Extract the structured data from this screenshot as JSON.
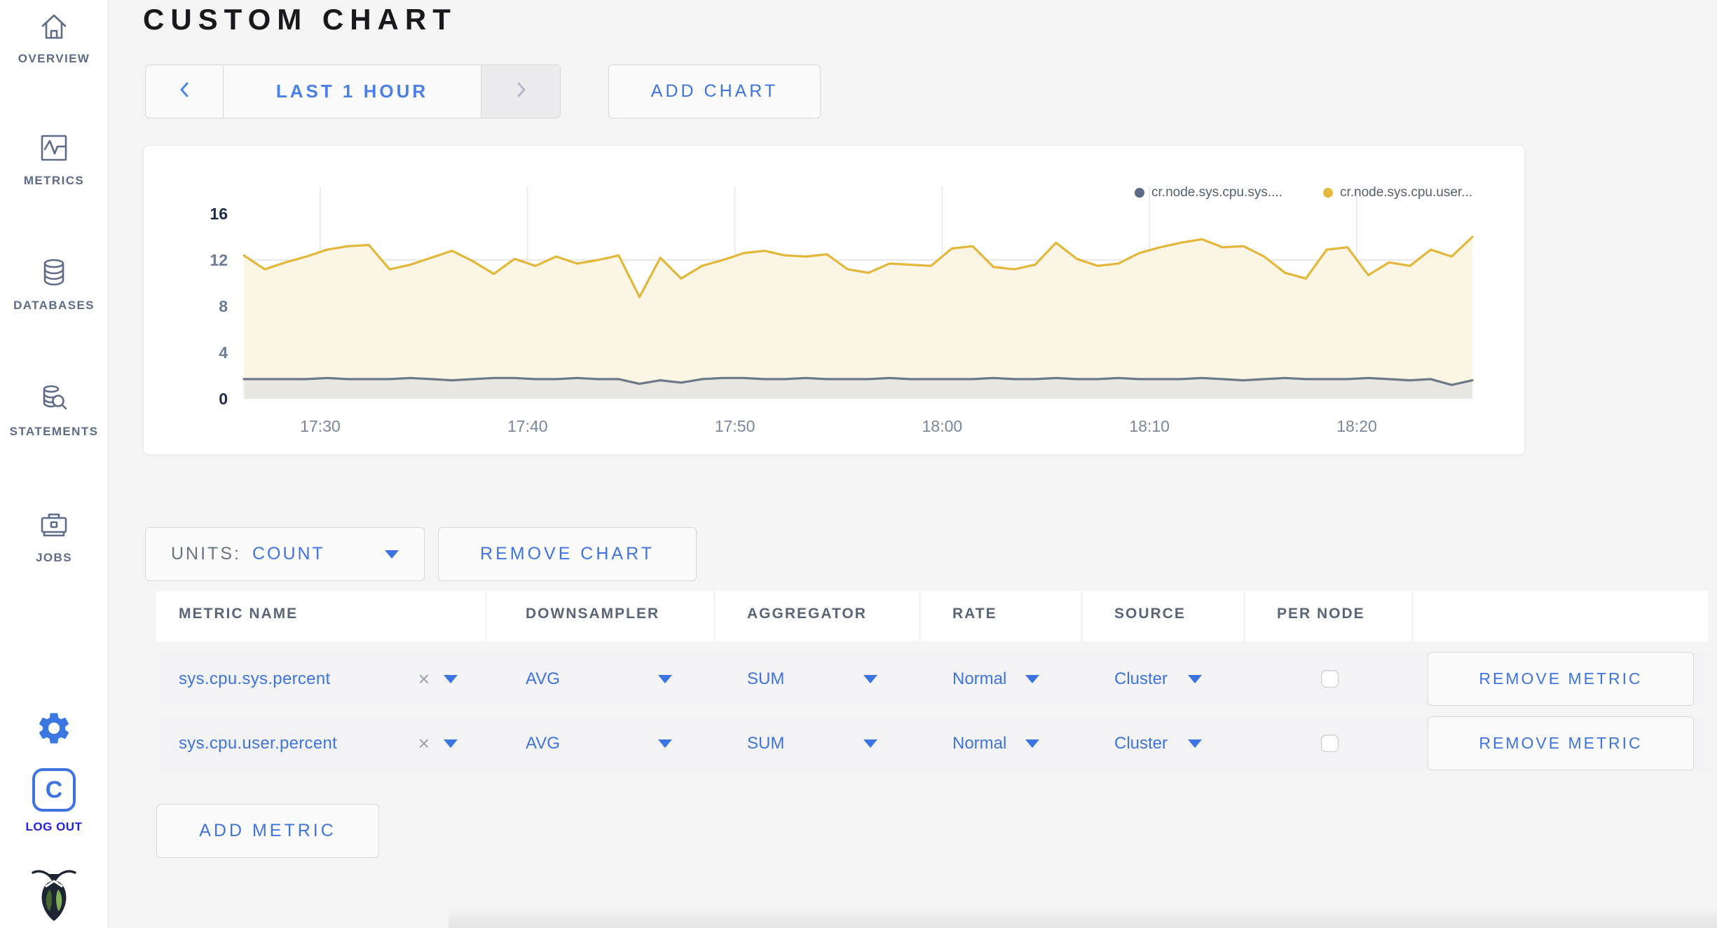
{
  "sidebar": {
    "items": [
      {
        "label": "OVERVIEW",
        "icon": "home-icon"
      },
      {
        "label": "METRICS",
        "icon": "metrics-icon"
      },
      {
        "label": "DATABASES",
        "icon": "databases-icon"
      },
      {
        "label": "STATEMENTS",
        "icon": "statements-icon"
      },
      {
        "label": "JOBS",
        "icon": "jobs-icon"
      }
    ],
    "logout": {
      "label": "LOG OUT",
      "monogram": "C"
    }
  },
  "header": {
    "title": "CUSTOM CHART"
  },
  "toolbar": {
    "time_range": "LAST 1 HOUR",
    "add_chart": "ADD CHART"
  },
  "chart_controls": {
    "units_label": "UNITS:",
    "units_value": "COUNT",
    "remove_chart": "REMOVE CHART",
    "add_metric": "ADD METRIC"
  },
  "table": {
    "headers": [
      "METRIC NAME",
      "DOWNSAMPLER",
      "AGGREGATOR",
      "RATE",
      "SOURCE",
      "PER NODE",
      ""
    ],
    "rows": [
      {
        "metric": "sys.cpu.sys.percent",
        "clear": "×",
        "downsampler": "AVG",
        "aggregator": "SUM",
        "rate": "Normal",
        "source": "Cluster",
        "per_node_checked": false,
        "action": "REMOVE METRIC"
      },
      {
        "metric": "sys.cpu.user.percent",
        "clear": "×",
        "downsampler": "AVG",
        "aggregator": "SUM",
        "rate": "Normal",
        "source": "Cluster",
        "per_node_checked": false,
        "action": "REMOVE METRIC"
      }
    ]
  },
  "chart_data": {
    "type": "line",
    "title": "",
    "xlabel": "",
    "ylabel": "",
    "ylim": [
      0,
      16
    ],
    "y_ticks": [
      0,
      4,
      8,
      12,
      16
    ],
    "grid_y": [
      4,
      8,
      12
    ],
    "x_ticks": [
      "17:30",
      "17:40",
      "17:50",
      "18:00",
      "18:10",
      "18:20"
    ],
    "time_window": "17:26 - 18:26",
    "grid": true,
    "legend_position": "top-right",
    "legend": [
      {
        "label": "cr.node.sys.cpu.sys....",
        "color": "#5d6b89"
      },
      {
        "label": "cr.node.sys.cpu.user...",
        "color": "#e3ba3d"
      }
    ],
    "series": [
      {
        "name": "cr.node.sys.cpu.sys....",
        "line_color": "#6e7987",
        "fill_color": "#e9e7e1",
        "values": [
          1.7,
          1.7,
          1.7,
          1.7,
          1.8,
          1.7,
          1.7,
          1.7,
          1.8,
          1.7,
          1.6,
          1.7,
          1.8,
          1.8,
          1.7,
          1.7,
          1.8,
          1.7,
          1.7,
          1.3,
          1.6,
          1.4,
          1.7,
          1.8,
          1.8,
          1.7,
          1.7,
          1.8,
          1.7,
          1.7,
          1.7,
          1.8,
          1.7,
          1.7,
          1.7,
          1.7,
          1.8,
          1.7,
          1.7,
          1.8,
          1.7,
          1.7,
          1.8,
          1.7,
          1.7,
          1.7,
          1.8,
          1.7,
          1.6,
          1.7,
          1.8,
          1.7,
          1.7,
          1.7,
          1.8,
          1.7,
          1.6,
          1.7,
          1.2,
          1.6
        ]
      },
      {
        "name": "cr.node.sys.cpu.user...",
        "line_color": "#e2b73a",
        "fill_color": "#faf5e4",
        "values": [
          12.4,
          11.2,
          11.8,
          12.3,
          12.9,
          13.2,
          13.3,
          11.2,
          11.6,
          12.2,
          12.8,
          11.9,
          10.8,
          12.1,
          11.5,
          12.3,
          11.7,
          12.0,
          12.4,
          8.8,
          12.2,
          10.4,
          11.5,
          12.0,
          12.6,
          12.8,
          12.4,
          12.3,
          12.5,
          11.2,
          10.9,
          11.7,
          11.6,
          11.5,
          13.0,
          13.2,
          11.4,
          11.2,
          11.6,
          13.5,
          12.1,
          11.5,
          11.7,
          12.6,
          13.1,
          13.5,
          13.8,
          13.1,
          13.2,
          12.3,
          10.9,
          10.4,
          12.9,
          13.1,
          10.7,
          11.8,
          11.5,
          12.9,
          12.3,
          14.0
        ]
      }
    ]
  },
  "colors": {
    "accent_blue": "#3f74e0",
    "logout_blue": "#2121e8",
    "sidebar_gray": "#5f6c87",
    "page_bg": "#f5f5f6"
  }
}
